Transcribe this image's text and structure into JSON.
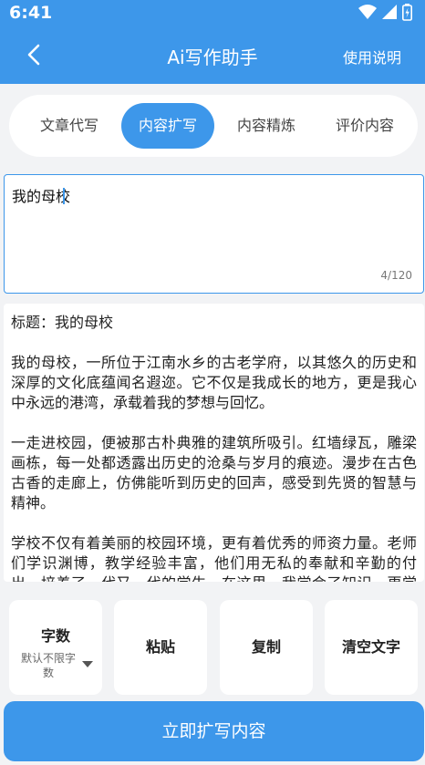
{
  "status_bar": {
    "time": "6:41"
  },
  "header": {
    "title": "Ai写作助手",
    "help_label": "使用说明"
  },
  "tabs": [
    {
      "label": "文章代写",
      "active": false
    },
    {
      "label": "内容扩写",
      "active": true
    },
    {
      "label": "内容精炼",
      "active": false
    },
    {
      "label": "评价内容",
      "active": false
    }
  ],
  "input": {
    "value": "我的母校",
    "counter": "4/120"
  },
  "result": {
    "paragraphs": [
      "标题：我的母校",
      "我的母校，一所位于江南水乡的古老学府，以其悠久的历史和深厚的文化底蕴闻名遐迩。它不仅是我成长的地方，更是我心中永远的港湾，承载着我的梦想与回忆。",
      "一走进校园，便被那古朴典雅的建筑所吸引。红墙绿瓦，雕梁画栋，每一处都透露出历史的沧桑与岁月的痕迹。漫步在古色古香的走廊上，仿佛能听到历史的回声，感受到先贤的智慧与精神。",
      "学校不仅有着美丽的校园环境，更有着优秀的师资力量。老师们学识渊博，教学经验丰富，他们用无私的奉献和辛勤的付出，培养了一代又一代的学生。在这里，我学会了知识，更学会了做人的道理。"
    ]
  },
  "options": {
    "word_count": {
      "label": "字数",
      "value": "默认不限字数"
    },
    "paste_label": "粘贴",
    "copy_label": "复制",
    "clear_label": "清空文字"
  },
  "cta_label": "立即扩写内容",
  "colors": {
    "accent": "#3d97ea",
    "background": "#f2f3f5"
  }
}
